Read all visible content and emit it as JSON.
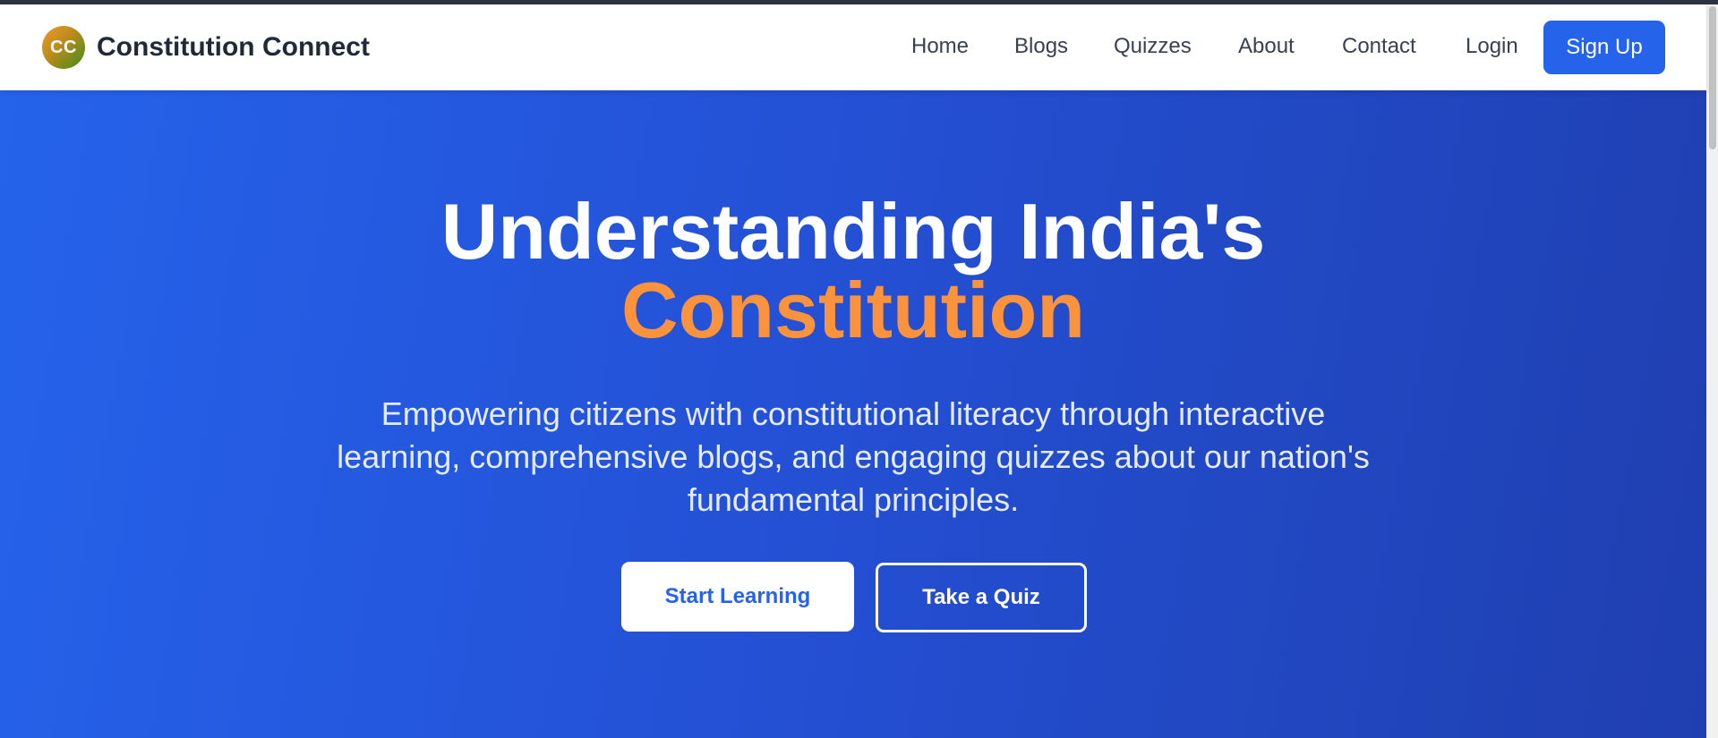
{
  "brand": {
    "logo_text": "CC",
    "name": "Constitution Connect"
  },
  "nav": {
    "home": "Home",
    "blogs": "Blogs",
    "quizzes": "Quizzes",
    "about": "About",
    "contact": "Contact",
    "login": "Login",
    "signup": "Sign Up"
  },
  "hero": {
    "title_line1": "Understanding India's",
    "title_line2": "Constitution",
    "subtitle": "Empowering citizens with constitutional literacy through interactive learning, comprehensive blogs, and engaging quizzes about our nation's fundamental principles.",
    "primary_cta": "Start Learning",
    "secondary_cta": "Take a Quiz"
  },
  "colors": {
    "accent": "#2563eb",
    "highlight": "#fb923c",
    "nav_text": "#374151",
    "brand_text": "#1f2937"
  }
}
